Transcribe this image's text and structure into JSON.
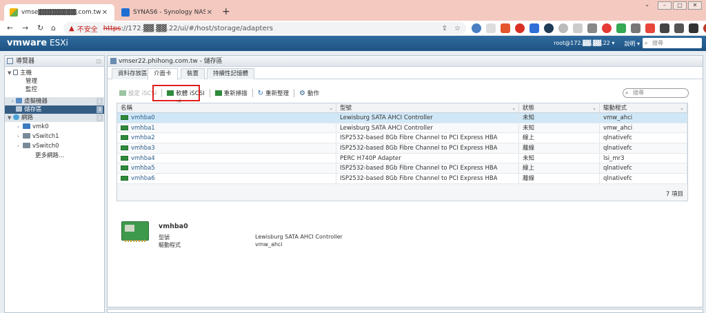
{
  "browser": {
    "tabs": [
      {
        "title": "vmse▓▓▓▓▓▓▓▓.com.tw - VM",
        "active": true
      },
      {
        "title": "SYNAS6 - Synology NAS",
        "active": false
      }
    ],
    "new_tab": "+",
    "url": {
      "warning": "不安全",
      "scheme": "https",
      "rest": "://172.▓▓.▓▓.22/ui/#/host/storage/adapters"
    }
  },
  "esxi": {
    "brand": "vmware",
    "product": "ESXi",
    "user": "root@172.▓▓.▓▓.22 ▾",
    "help": "說明 ▾",
    "search_placeholder": "搜尋"
  },
  "navigator": {
    "title": "導覽器",
    "items": [
      {
        "label": "主機",
        "level": 0
      },
      {
        "label": "管理",
        "level": 1
      },
      {
        "label": "監控",
        "level": 1
      },
      {
        "label": "虛擬機器",
        "badge": "1"
      },
      {
        "label": "儲存區",
        "badge": "3"
      },
      {
        "label": "網路",
        "badge": "2"
      },
      {
        "label": "vmk0"
      },
      {
        "label": "vSwitch1"
      },
      {
        "label": "vSwitch0"
      },
      {
        "label": "更多網路..."
      }
    ]
  },
  "main": {
    "title": "vmser22.phihong.com.tw - 儲存區",
    "tabs": [
      "資料存放區",
      "介面卡",
      "裝置",
      "持續性記憶體"
    ],
    "active_tab": 1,
    "toolbar": {
      "configure_iscsi": "設定 iSCSI",
      "software_iscsi": "軟體 iSCSI",
      "rescan": "重新掃描",
      "refresh": "重新整理",
      "actions": "動作"
    },
    "grid_search_placeholder": "搜尋",
    "columns": [
      "名稱",
      "型號",
      "狀態",
      "驅動程式"
    ],
    "rows": [
      {
        "name": "vmhba0",
        "model": "Lewisburg SATA AHCI Controller",
        "status": "未知",
        "driver": "vmw_ahci"
      },
      {
        "name": "vmhba1",
        "model": "Lewisburg SATA AHCI Controller",
        "status": "未知",
        "driver": "vmw_ahci"
      },
      {
        "name": "vmhba2",
        "model": "ISP2532-based 8Gb Fibre Channel to PCI Express HBA",
        "status": "線上",
        "driver": "qlnativefc"
      },
      {
        "name": "vmhba3",
        "model": "ISP2532-based 8Gb Fibre Channel to PCI Express HBA",
        "status": "離線",
        "driver": "qlnativefc"
      },
      {
        "name": "vmhba4",
        "model": "PERC H740P Adapter",
        "status": "未知",
        "driver": "lsi_mr3"
      },
      {
        "name": "vmhba5",
        "model": "ISP2532-based 8Gb Fibre Channel to PCI Express HBA",
        "status": "線上",
        "driver": "qlnativefc"
      },
      {
        "name": "vmhba6",
        "model": "ISP2532-based 8Gb Fibre Channel to PCI Express HBA",
        "status": "離線",
        "driver": "qlnativefc"
      }
    ],
    "item_count": "7 項目",
    "detail": {
      "name": "vmhba0",
      "model_label": "型號",
      "model_value": "Lewisburg SATA AHCI Controller",
      "driver_label": "驅動程式",
      "driver_value": "vmw_ahci"
    }
  },
  "colors": {
    "tabbar": "#f3c9c0",
    "header": "#1e5383",
    "selected_nav": "#355d84",
    "selected_row": "#cfe7f7",
    "highlight_box": "#e21b1b"
  }
}
